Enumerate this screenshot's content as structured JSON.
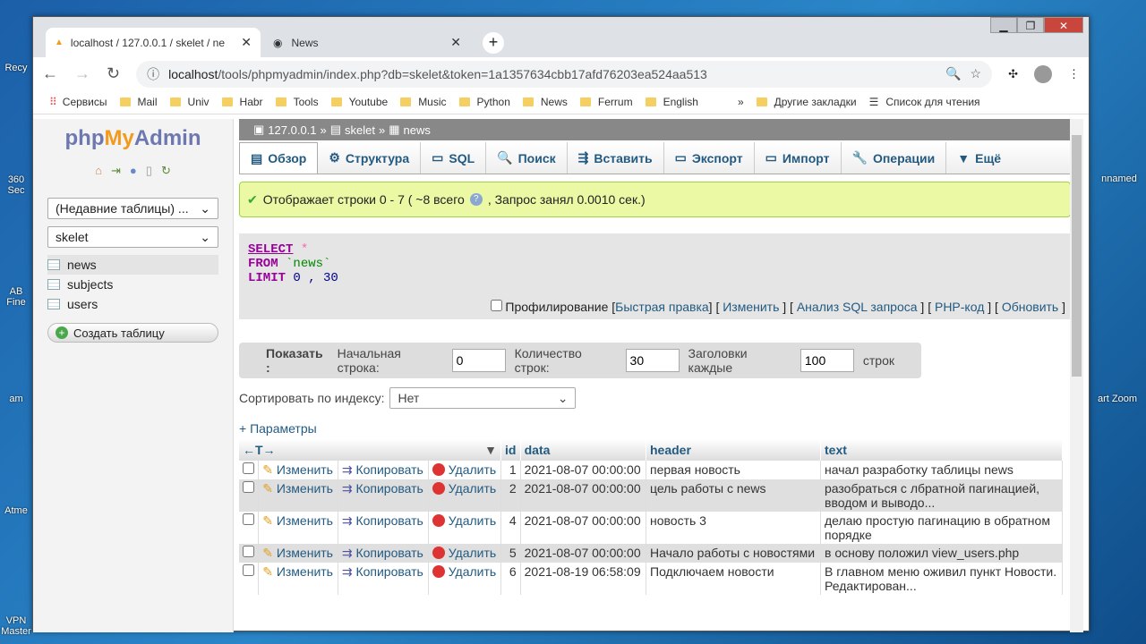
{
  "desktop": {
    "left_icons": [
      "Recy",
      "360 Sec",
      "AB Fine",
      "am",
      "Atme",
      "VPN Master"
    ],
    "right_icons": [
      "nnamed",
      "art Zoom"
    ]
  },
  "browser": {
    "tabs": [
      {
        "label": "localhost / 127.0.0.1 / skelet / ne"
      },
      {
        "label": "News"
      }
    ],
    "url_host": "localhost",
    "url_rest": "/tools/phpmyadmin/index.php?db=skelet&token=1a1357634cbb17afd76203ea524aa513",
    "bookmarks": [
      "Сервисы",
      "Mail",
      "Univ",
      "Habr",
      "Tools",
      "Youtube",
      "Music",
      "Python",
      "News",
      "Ferrum",
      "English"
    ],
    "bookmarks_more": "»",
    "other_bookmarks": "Другие закладки",
    "reading_list": "Список для чтения"
  },
  "sidebar": {
    "logo_php": "php",
    "logo_my": "My",
    "logo_admin": "Admin",
    "recent": "(Недавние таблицы) ...",
    "db": "skelet",
    "tables": [
      "news",
      "subjects",
      "users"
    ],
    "create": "Создать таблицу"
  },
  "main": {
    "crumbs": [
      "127.0.0.1",
      "skelet",
      "news"
    ],
    "tabs": [
      "Обзор",
      "Структура",
      "SQL",
      "Поиск",
      "Вставить",
      "Экспорт",
      "Импорт",
      "Операции",
      "Ещё"
    ],
    "message_a": "Отображает строки 0 - 7 ( ~8 всего",
    "message_b": ", Запрос занял 0.0010 сек.)",
    "sql": {
      "select": "SELECT",
      "star": "*",
      "from": "FROM",
      "table": "`news`",
      "limit": "LIMIT",
      "limit_vals": "0 , 30"
    },
    "profiling": "Профилирование",
    "sql_links": [
      "Быстрая правка",
      "Изменить",
      "Анализ SQL запроса",
      "PHP-код",
      "Обновить"
    ],
    "show": {
      "label": "Показать :",
      "start_label": "Начальная строка:",
      "start": "0",
      "count_label": "Количество строк:",
      "count": "30",
      "headers_label": "Заголовки каждые",
      "headers": "100",
      "rows": "строк"
    },
    "sort_label": "Сортировать по индексу:",
    "sort_value": "Нет",
    "params": "+ Параметры",
    "actions": {
      "edit": "Изменить",
      "copy": "Копировать",
      "delete": "Удалить"
    },
    "columns": [
      "id",
      "data",
      "header",
      "text"
    ],
    "rows": [
      {
        "id": "1",
        "data": "2021-08-07 00:00:00",
        "header": "первая новость",
        "text": "начал разработку таблицы news"
      },
      {
        "id": "2",
        "data": "2021-08-07 00:00:00",
        "header": "цель работы с news",
        "text": "разобраться с лбратной пагинацией, вводом и выводо..."
      },
      {
        "id": "4",
        "data": "2021-08-07 00:00:00",
        "header": "новость 3",
        "text": "делаю простую пагинацию в обратном порядке"
      },
      {
        "id": "5",
        "data": "2021-08-07 00:00:00",
        "header": "Начало работы с новостями",
        "text": "в основу положил view_users.php"
      },
      {
        "id": "6",
        "data": "2021-08-19 06:58:09",
        "header": "Подключаем новости",
        "text": "В главном меню оживил пункт Новости. Редактирован..."
      }
    ]
  }
}
